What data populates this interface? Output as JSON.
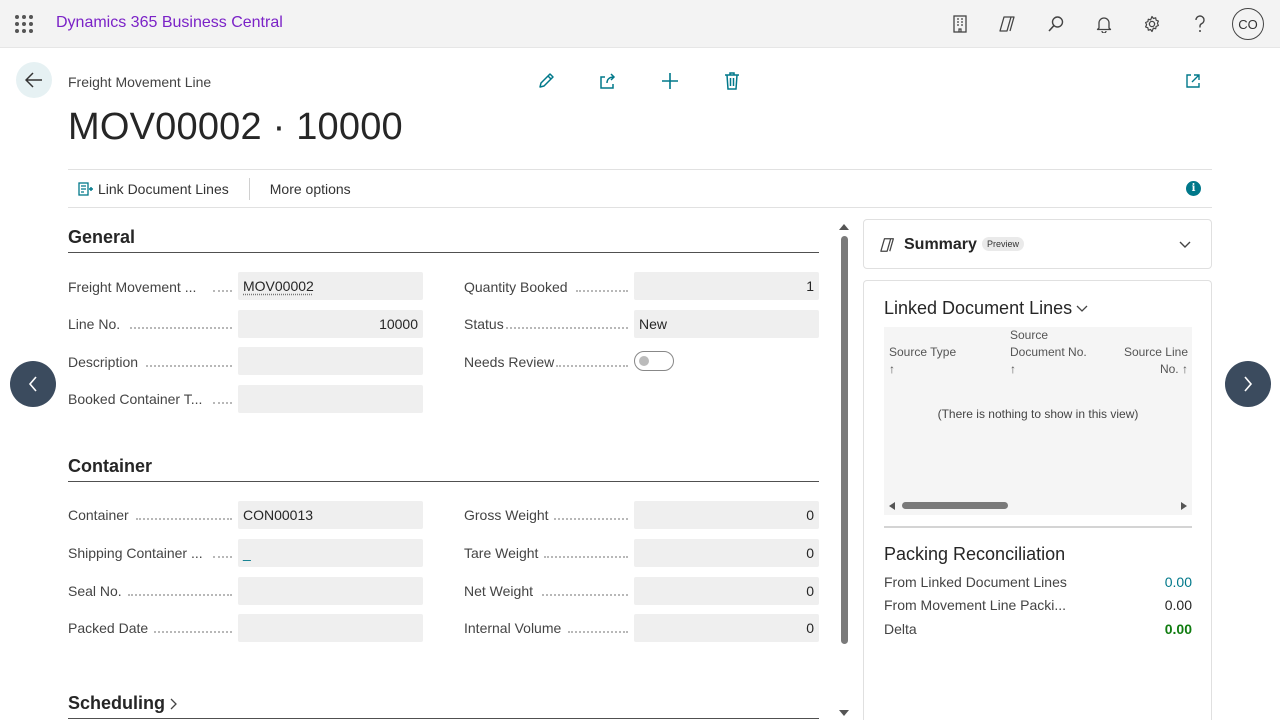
{
  "app": {
    "title": "Dynamics 365 Business Central",
    "avatar_initials": "CO"
  },
  "topbar_icons": [
    "company-icon",
    "copilot-icon",
    "search-icon",
    "bell-icon",
    "gear-icon",
    "help-icon"
  ],
  "page": {
    "caption": "Freight Movement Line",
    "title": "MOV00002 · 10000"
  },
  "actions": {
    "link_document_lines": "Link Document Lines",
    "more_options": "More options"
  },
  "general": {
    "title": "General",
    "fields_left": [
      {
        "label": "Freight Movement ...",
        "value": "MOV00002",
        "align": "left"
      },
      {
        "label": "Line No.",
        "value": "10000",
        "align": "right"
      },
      {
        "label": "Description",
        "value": "",
        "align": "left"
      },
      {
        "label": "Booked Container T...",
        "value": "",
        "align": "left"
      }
    ],
    "fields_right": [
      {
        "label": "Quantity Booked",
        "value": "1",
        "align": "right"
      },
      {
        "label": "Status",
        "value": "New",
        "align": "left"
      },
      {
        "label": "Needs Review",
        "value": "",
        "align": "left"
      }
    ]
  },
  "container": {
    "title": "Container",
    "fields_left": [
      {
        "label": "Container",
        "value": "CON00013"
      },
      {
        "label": "Shipping Container ...",
        "value": "_"
      },
      {
        "label": "Seal No.",
        "value": ""
      },
      {
        "label": "Packed Date",
        "value": ""
      }
    ],
    "fields_right": [
      {
        "label": "Gross Weight",
        "value": "0"
      },
      {
        "label": "Tare Weight",
        "value": "0"
      },
      {
        "label": "Net Weight",
        "value": "0"
      },
      {
        "label": "Internal Volume",
        "value": "0"
      }
    ]
  },
  "scheduling": {
    "title": "Scheduling"
  },
  "summary": {
    "title": "Summary",
    "badge": "Preview"
  },
  "linked_document_lines": {
    "title": "Linked Document Lines",
    "col1": "Source Type",
    "col2_line1": "Source",
    "col2_line2": "Document No.",
    "col3_line1": "Source Line",
    "col3_line2": "No.",
    "sort_arrow": "↑",
    "empty": "(There is nothing to show in this view)"
  },
  "packing_reconciliation": {
    "title": "Packing Reconciliation",
    "rows": [
      {
        "label": "From Linked Document Lines",
        "value": "0.00"
      },
      {
        "label": "From Movement Line Packi...",
        "value": "0.00"
      },
      {
        "label": "Delta",
        "value": "0.00"
      }
    ]
  },
  "colors": {
    "accent": "#00788a",
    "brand": "#7b22c7",
    "delta_green": "#107c10",
    "nav_arrow": "#3b4b5e"
  }
}
